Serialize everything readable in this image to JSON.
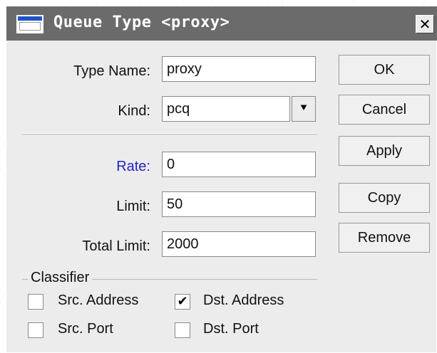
{
  "window": {
    "title": "Queue Type <proxy>",
    "close_glyph": "✕"
  },
  "form": {
    "type_name": {
      "label": "Type Name:",
      "value": "proxy"
    },
    "kind": {
      "label": "Kind:",
      "value": "pcq",
      "dropdown_glyph": "⯆"
    },
    "rate": {
      "label": "Rate:",
      "value": "0"
    },
    "limit": {
      "label": "Limit:",
      "value": "50"
    },
    "total_limit": {
      "label": "Total Limit:",
      "value": "2000"
    }
  },
  "classifier": {
    "label": "Classifier",
    "options": [
      {
        "label": "Src. Address",
        "checked": false
      },
      {
        "label": "Dst. Address",
        "checked": true
      },
      {
        "label": "Src. Port",
        "checked": false
      },
      {
        "label": "Dst. Port",
        "checked": false
      }
    ]
  },
  "buttons": {
    "ok": "OK",
    "cancel": "Cancel",
    "apply": "Apply",
    "copy": "Copy",
    "remove": "Remove"
  },
  "colors": {
    "titlebar": "#6b6b6b",
    "link_label": "#2323c8",
    "window_bg": "#ececec"
  }
}
